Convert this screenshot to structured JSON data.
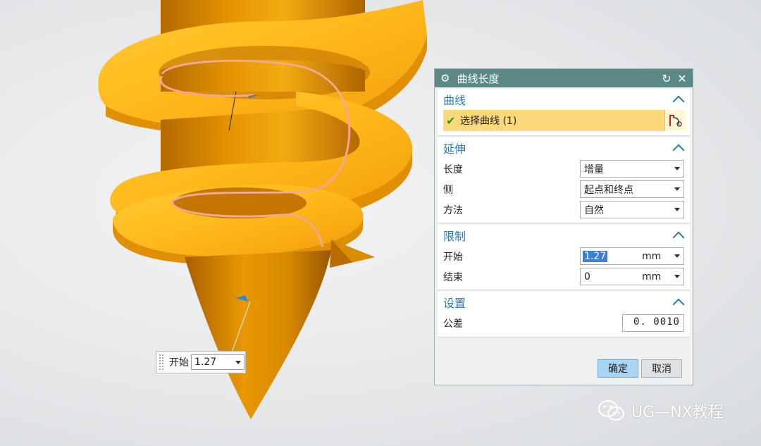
{
  "dialog": {
    "title": "曲线长度",
    "sections": {
      "curve": {
        "header": "曲线",
        "select_label": "选择曲线 (1)"
      },
      "extend": {
        "header": "延伸",
        "rows": [
          {
            "label": "长度",
            "value": "增量"
          },
          {
            "label": "侧",
            "value": "起点和终点"
          },
          {
            "label": "方法",
            "value": "自然"
          }
        ]
      },
      "limit": {
        "header": "限制",
        "rows": [
          {
            "label": "开始",
            "value": "1.27",
            "unit": "mm"
          },
          {
            "label": "结束",
            "value": "0",
            "unit": "mm"
          }
        ]
      },
      "settings": {
        "header": "设置",
        "tolerance_label": "公差",
        "tolerance_value": "0. 0010"
      }
    },
    "buttons": {
      "ok": "确定",
      "cancel": "取消"
    }
  },
  "onscreen_input": {
    "label": "开始",
    "value": "1.27"
  },
  "watermark": "UG—NX教程",
  "colors": {
    "title_bar": "#5b8a86",
    "section_header": "#2b78b6",
    "selection_row": "#fbd97a",
    "ok_button": "#a9d4f3",
    "model": "#f2a20e"
  },
  "icons": [
    "gear-icon",
    "reset-icon",
    "close-icon",
    "check-icon",
    "curve-select-icon",
    "chevron-up-icon",
    "dropdown-arrow-icon",
    "wechat-icon"
  ]
}
